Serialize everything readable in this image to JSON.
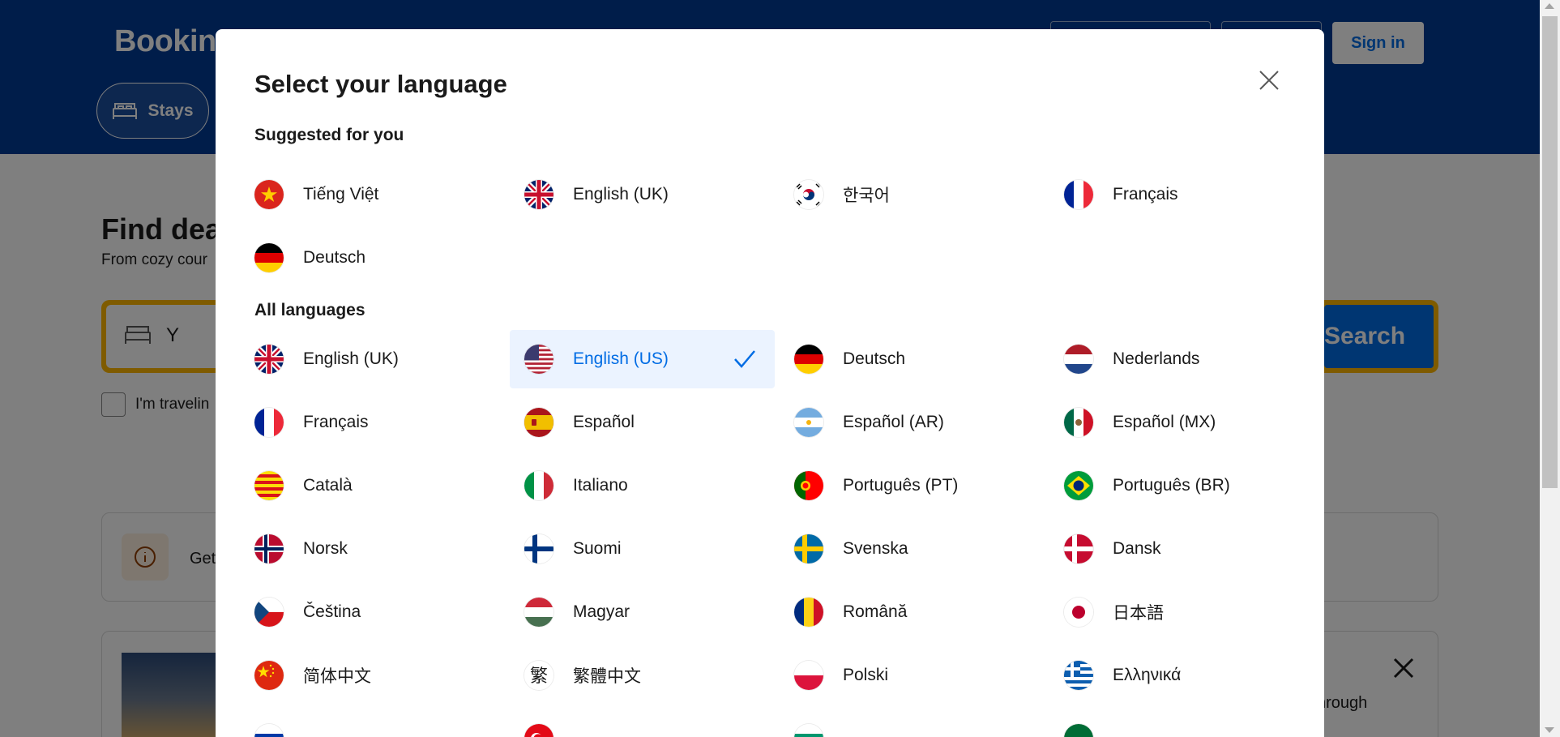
{
  "header": {
    "logo": "Booking",
    "signin_label": "Sign in",
    "stays_label": "Stays"
  },
  "hero": {
    "title": "Find dea",
    "subtitle": "From cozy cour",
    "field_value": "Y",
    "search_label": "Search",
    "traveling_label": "I'm travelin"
  },
  "info": {
    "text": "Get"
  },
  "promo": {
    "text": "hrough"
  },
  "modal": {
    "title": "Select your language",
    "suggested_title": "Suggested for you",
    "all_title": "All languages",
    "suggested": [
      {
        "name": "Tiếng Việt",
        "flag": "vn"
      },
      {
        "name": "English (UK)",
        "flag": "gb"
      },
      {
        "name": "한국어",
        "flag": "kr"
      },
      {
        "name": "Français",
        "flag": "fr"
      },
      {
        "name": "Deutsch",
        "flag": "de"
      }
    ],
    "all": [
      {
        "name": "English (UK)",
        "flag": "gb"
      },
      {
        "name": "English (US)",
        "flag": "us",
        "selected": true
      },
      {
        "name": "Deutsch",
        "flag": "de"
      },
      {
        "name": "Nederlands",
        "flag": "nl"
      },
      {
        "name": "Français",
        "flag": "fr"
      },
      {
        "name": "Español",
        "flag": "es"
      },
      {
        "name": "Español (AR)",
        "flag": "ar"
      },
      {
        "name": "Español (MX)",
        "flag": "mx"
      },
      {
        "name": "Català",
        "flag": "ca"
      },
      {
        "name": "Italiano",
        "flag": "it"
      },
      {
        "name": "Português (PT)",
        "flag": "pt"
      },
      {
        "name": "Português (BR)",
        "flag": "br"
      },
      {
        "name": "Norsk",
        "flag": "no"
      },
      {
        "name": "Suomi",
        "flag": "fi"
      },
      {
        "name": "Svenska",
        "flag": "se"
      },
      {
        "name": "Dansk",
        "flag": "dk"
      },
      {
        "name": "Čeština",
        "flag": "cz"
      },
      {
        "name": "Magyar",
        "flag": "hu"
      },
      {
        "name": "Română",
        "flag": "ro"
      },
      {
        "name": "日本語",
        "flag": "jp"
      },
      {
        "name": "简体中文",
        "flag": "cn"
      },
      {
        "name": "繁體中文",
        "flag": "tw-char"
      },
      {
        "name": "Polski",
        "flag": "pl"
      },
      {
        "name": "Ελληνικά",
        "flag": "gr"
      },
      {
        "name": "",
        "flag": "ru"
      },
      {
        "name": "",
        "flag": "tr"
      },
      {
        "name": "",
        "flag": "bg"
      },
      {
        "name": "",
        "flag": "sa"
      }
    ]
  },
  "colors": {
    "brand_blue": "#003b95",
    "accent_blue": "#006ce4",
    "selected_bg": "#ebf3ff",
    "search_yellow": "#ffb700"
  }
}
